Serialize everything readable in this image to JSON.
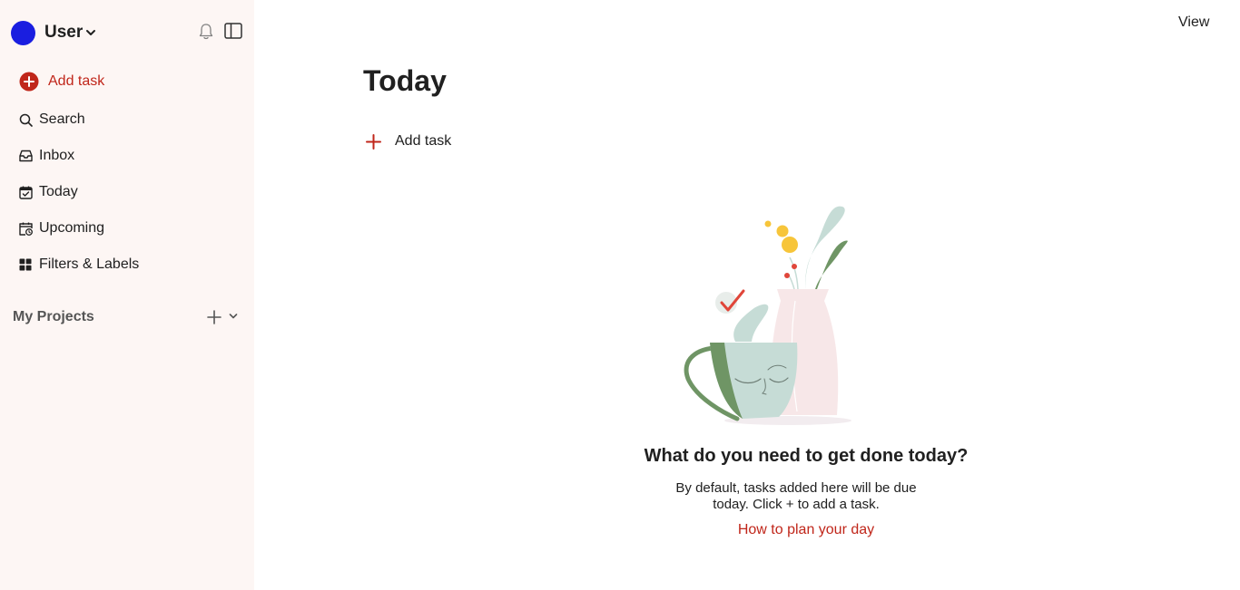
{
  "user": {
    "name": "User",
    "avatar_color": "#1a1ee0"
  },
  "sidebar": {
    "add_task_label": "Add task",
    "items": [
      {
        "label": "Search",
        "icon": "search-icon"
      },
      {
        "label": "Inbox",
        "icon": "inbox-icon"
      },
      {
        "label": "Today",
        "icon": "calendar-today-icon"
      },
      {
        "label": "Upcoming",
        "icon": "calendar-upcoming-icon"
      },
      {
        "label": "Filters & Labels",
        "icon": "grid-icon"
      }
    ],
    "projects_title": "My Projects"
  },
  "main": {
    "view_label": "View",
    "title": "Today",
    "add_task_label": "Add task",
    "empty_state": {
      "title": "What do you need to get done today?",
      "description": "By default, tasks added here will be due today. Click + to add a task.",
      "link": "How to plan your day"
    }
  },
  "colors": {
    "accent": "#c0261a",
    "sidebar_bg": "#fdf6f4"
  }
}
